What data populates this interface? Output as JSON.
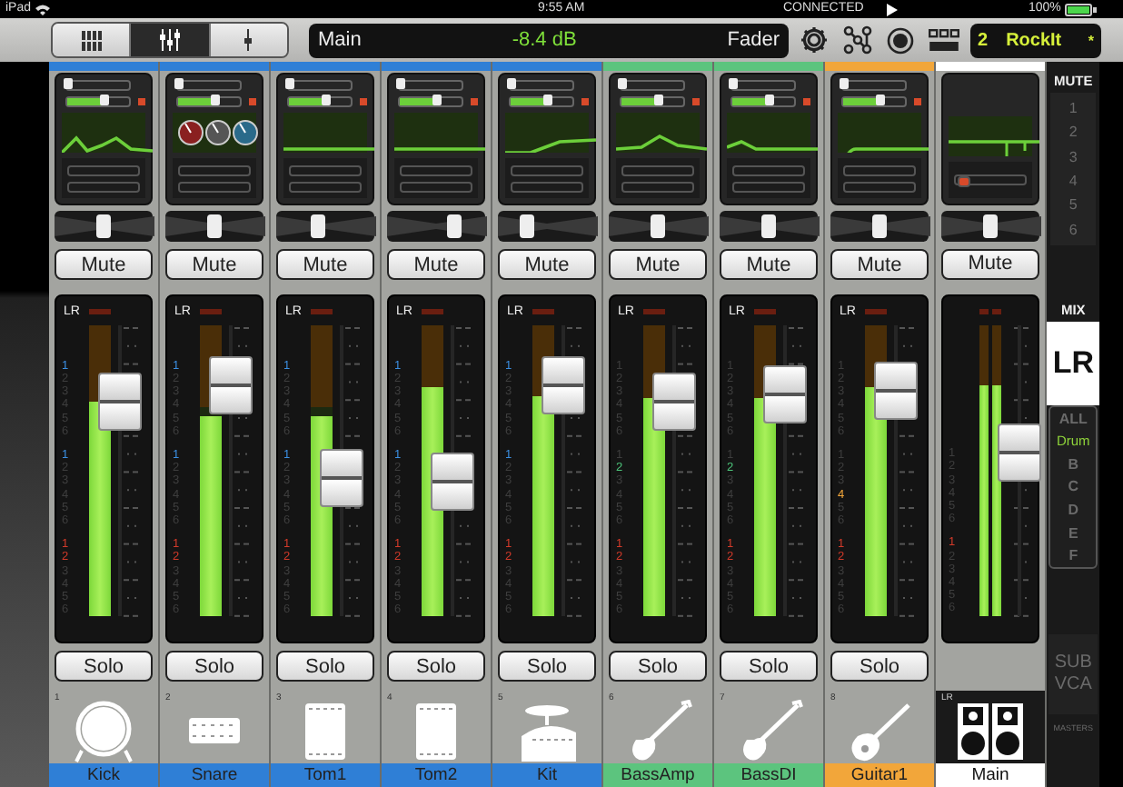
{
  "status_bar": {
    "device": "iPad",
    "time": "9:55 AM",
    "connection": "CONNECTED",
    "battery": "100%"
  },
  "toolbar": {
    "views": [
      {
        "selected": false
      },
      {
        "selected": true
      },
      {
        "selected": false
      }
    ],
    "display": {
      "target": "Main",
      "value": "-8.4 dB",
      "mode": "Fader"
    },
    "scene": {
      "number": "2",
      "name": "RockIt",
      "modified": "*"
    }
  },
  "channels": [
    {
      "kind": "input",
      "number": "1",
      "name": "Kick",
      "color": "#2f7fd6",
      "inputs": [
        {
          "level": 0
        },
        {
          "level": 0.6
        }
      ],
      "pan": {
        "level": 0.5
      },
      "mute": {
        "label": "Mute",
        "on": false
      },
      "bus": "LR",
      "groups": [
        {
          "digits": [
            "1",
            "2",
            "3",
            "4",
            "5",
            "6"
          ],
          "lit": [
            true,
            false,
            false,
            false,
            false,
            false
          ],
          "color": "#3b8ee0"
        },
        {
          "digits": [
            "1",
            "2",
            "3",
            "4",
            "5",
            "6"
          ],
          "lit": [
            true,
            false,
            false,
            false,
            false,
            false
          ],
          "color": "#3b8ee0"
        },
        {
          "digits": [
            "1",
            "2",
            "3",
            "4",
            "5",
            "6"
          ],
          "lit": [
            true,
            true,
            false,
            false,
            false,
            false
          ],
          "color": "#d23a2a"
        }
      ],
      "meter": {
        "level": 0.74
      },
      "fader": {
        "level": 0.7
      },
      "solo": {
        "label": "Solo",
        "on": false
      }
    },
    {
      "kind": "input",
      "number": "2",
      "name": "Snare",
      "color": "#2f7fd6",
      "inputs": [
        {
          "level": 0
        },
        {
          "level": 0.6
        }
      ],
      "pan": {
        "level": 0.5
      },
      "mute": {
        "label": "Mute",
        "on": false
      },
      "bus": "LR",
      "groups": [
        {
          "digits": [
            "1",
            "2",
            "3",
            "4",
            "5",
            "6"
          ],
          "lit": [
            true,
            false,
            false,
            false,
            false,
            false
          ],
          "color": "#3b8ee0"
        },
        {
          "digits": [
            "1",
            "2",
            "3",
            "4",
            "5",
            "6"
          ],
          "lit": [
            true,
            false,
            false,
            false,
            false,
            false
          ],
          "color": "#3b8ee0"
        },
        {
          "digits": [
            "1",
            "2",
            "3",
            "4",
            "5",
            "6"
          ],
          "lit": [
            true,
            true,
            false,
            false,
            false,
            false
          ],
          "color": "#d23a2a"
        }
      ],
      "meter": {
        "level": 0.69
      },
      "fader": {
        "level": 0.745
      },
      "solo": {
        "label": "Solo",
        "on": false
      }
    },
    {
      "kind": "input",
      "number": "3",
      "name": "Tom1",
      "color": "#2f7fd6",
      "inputs": [
        {
          "level": 0
        },
        {
          "level": 0.6
        }
      ],
      "pan": {
        "level": 0.42
      },
      "mute": {
        "label": "Mute",
        "on": false
      },
      "bus": "LR",
      "groups": [
        {
          "digits": [
            "1",
            "2",
            "3",
            "4",
            "5",
            "6"
          ],
          "lit": [
            true,
            false,
            false,
            false,
            false,
            false
          ],
          "color": "#3b8ee0"
        },
        {
          "digits": [
            "1",
            "2",
            "3",
            "4",
            "5",
            "6"
          ],
          "lit": [
            true,
            false,
            false,
            false,
            false,
            false
          ],
          "color": "#3b8ee0"
        },
        {
          "digits": [
            "1",
            "2",
            "3",
            "4",
            "5",
            "6"
          ],
          "lit": [
            true,
            true,
            false,
            false,
            false,
            false
          ],
          "color": "#d23a2a"
        }
      ],
      "meter": {
        "level": 0.69
      },
      "fader": {
        "level": 0.48
      },
      "solo": {
        "label": "Solo",
        "on": false
      }
    },
    {
      "kind": "input",
      "number": "4",
      "name": "Tom2",
      "color": "#2f7fd6",
      "inputs": [
        {
          "level": 0
        },
        {
          "level": 0.6
        }
      ],
      "pan": {
        "level": 0.68
      },
      "mute": {
        "label": "Mute",
        "on": false
      },
      "bus": "LR",
      "groups": [
        {
          "digits": [
            "1",
            "2",
            "3",
            "4",
            "5",
            "6"
          ],
          "lit": [
            true,
            false,
            false,
            false,
            false,
            false
          ],
          "color": "#3b8ee0"
        },
        {
          "digits": [
            "1",
            "2",
            "3",
            "4",
            "5",
            "6"
          ],
          "lit": [
            true,
            false,
            false,
            false,
            false,
            false
          ],
          "color": "#3b8ee0"
        },
        {
          "digits": [
            "1",
            "2",
            "3",
            "4",
            "5",
            "6"
          ],
          "lit": [
            true,
            true,
            false,
            false,
            false,
            false
          ],
          "color": "#d23a2a"
        }
      ],
      "meter": {
        "level": 0.79
      },
      "fader": {
        "level": 0.47
      },
      "solo": {
        "label": "Solo",
        "on": false
      }
    },
    {
      "kind": "input",
      "number": "5",
      "name": "Kit",
      "color": "#2f7fd6",
      "inputs": [
        {
          "level": 0
        },
        {
          "level": 0.6
        }
      ],
      "pan": {
        "level": 0.3
      },
      "mute": {
        "label": "Mute",
        "on": false
      },
      "bus": "LR",
      "groups": [
        {
          "digits": [
            "1",
            "2",
            "3",
            "4",
            "5",
            "6"
          ],
          "lit": [
            true,
            false,
            false,
            false,
            false,
            false
          ],
          "color": "#3b8ee0"
        },
        {
          "digits": [
            "1",
            "2",
            "3",
            "4",
            "5",
            "6"
          ],
          "lit": [
            true,
            false,
            false,
            false,
            false,
            false
          ],
          "color": "#3b8ee0"
        },
        {
          "digits": [
            "1",
            "2",
            "3",
            "4",
            "5",
            "6"
          ],
          "lit": [
            true,
            true,
            false,
            false,
            false,
            false
          ],
          "color": "#d23a2a"
        }
      ],
      "meter": {
        "level": 0.76
      },
      "fader": {
        "level": 0.745
      },
      "solo": {
        "label": "Solo",
        "on": false
      }
    },
    {
      "kind": "input",
      "number": "6",
      "name": "BassAmp",
      "color": "#5cc47e",
      "inputs": [
        {
          "level": 0
        },
        {
          "level": 0.6
        }
      ],
      "pan": {
        "level": 0.5
      },
      "mute": {
        "label": "Mute",
        "on": false
      },
      "bus": "LR",
      "groups": [
        {
          "digits": [
            "1",
            "2",
            "3",
            "4",
            "5",
            "6"
          ],
          "lit": [
            false,
            false,
            false,
            false,
            false,
            false
          ]
        },
        {
          "digits": [
            "1",
            "2",
            "3",
            "4",
            "5",
            "6"
          ],
          "lit": [
            false,
            true,
            false,
            false,
            false,
            false
          ],
          "color": "#4cc47a"
        },
        {
          "digits": [
            "1",
            "2",
            "3",
            "4",
            "5",
            "6"
          ],
          "lit": [
            true,
            true,
            false,
            false,
            false,
            false
          ],
          "color": "#d23a2a"
        }
      ],
      "meter": {
        "level": 0.75
      },
      "fader": {
        "level": 0.7
      },
      "solo": {
        "label": "Solo",
        "on": false
      }
    },
    {
      "kind": "input",
      "number": "7",
      "name": "BassDI",
      "color": "#5cc47e",
      "inputs": [
        {
          "level": 0
        },
        {
          "level": 0.6
        }
      ],
      "pan": {
        "level": 0.5
      },
      "mute": {
        "label": "Mute",
        "on": false
      },
      "bus": "LR",
      "groups": [
        {
          "digits": [
            "1",
            "2",
            "3",
            "4",
            "5",
            "6"
          ],
          "lit": [
            false,
            false,
            false,
            false,
            false,
            false
          ]
        },
        {
          "digits": [
            "1",
            "2",
            "3",
            "4",
            "5",
            "6"
          ],
          "lit": [
            false,
            true,
            false,
            false,
            false,
            false
          ],
          "color": "#4cc47a"
        },
        {
          "digits": [
            "1",
            "2",
            "3",
            "4",
            "5",
            "6"
          ],
          "lit": [
            true,
            true,
            false,
            false,
            false,
            false
          ],
          "color": "#d23a2a"
        }
      ],
      "meter": {
        "level": 0.75
      },
      "fader": {
        "level": 0.72
      },
      "solo": {
        "label": "Solo",
        "on": false
      }
    },
    {
      "kind": "input",
      "number": "8",
      "name": "Guitar1",
      "color": "#f2a63a",
      "inputs": [
        {
          "level": 0
        },
        {
          "level": 0.6
        }
      ],
      "pan": {
        "level": 0.5
      },
      "mute": {
        "label": "Mute",
        "on": false
      },
      "bus": "LR",
      "groups": [
        {
          "digits": [
            "1",
            "2",
            "3",
            "4",
            "5",
            "6"
          ],
          "lit": [
            false,
            false,
            false,
            false,
            false,
            false
          ]
        },
        {
          "digits": [
            "1",
            "2",
            "3",
            "4",
            "5",
            "6"
          ],
          "lit": [
            false,
            false,
            false,
            true,
            false,
            false
          ],
          "color": "#f2a63a"
        },
        {
          "digits": [
            "1",
            "2",
            "3",
            "4",
            "5",
            "6"
          ],
          "lit": [
            true,
            true,
            false,
            false,
            false,
            false
          ],
          "color": "#d23a2a"
        }
      ],
      "meter": {
        "level": 0.79
      },
      "fader": {
        "level": 0.73
      },
      "solo": {
        "label": "Solo",
        "on": false
      }
    },
    {
      "kind": "main",
      "number": "LR",
      "name": "Main",
      "color": "#ffffff",
      "pan": {
        "level": 0.5
      },
      "mute": {
        "label": "Mute",
        "on": false
      },
      "groups": [
        {
          "digits": [
            "1",
            "2",
            "3",
            "4",
            "5",
            "6"
          ],
          "lit": [
            false,
            false,
            false,
            false,
            false,
            false
          ]
        },
        {
          "digits": [
            "1",
            "2",
            "3",
            "4",
            "5",
            "6"
          ],
          "lit": [
            true,
            false,
            false,
            false,
            false,
            false
          ],
          "color": "#d23a2a"
        }
      ],
      "meter": {
        "level": 0.79
      },
      "fader": {
        "level": 0.55
      }
    }
  ],
  "side": {
    "mute_title": "MUTE",
    "mute_groups": [
      {
        "label": "1",
        "on": false
      },
      {
        "label": "2",
        "on": false
      },
      {
        "label": "3",
        "on": false
      },
      {
        "label": "4",
        "on": false
      },
      {
        "label": "5",
        "on": false
      },
      {
        "label": "6",
        "on": false
      }
    ],
    "mix_title": "MIX",
    "mix": [
      {
        "label": "LR",
        "selected": true
      },
      {
        "label": "ALL",
        "selected": false,
        "active": false
      },
      {
        "label": "Drum",
        "selected": false,
        "active": true
      },
      {
        "label": "B",
        "selected": false,
        "active": false
      },
      {
        "label": "C",
        "selected": false,
        "active": false
      },
      {
        "label": "D",
        "selected": false,
        "active": false
      },
      {
        "label": "E",
        "selected": false,
        "active": false
      },
      {
        "label": "F",
        "selected": false,
        "active": false
      }
    ],
    "sub": "SUB",
    "vca": "VCA",
    "masters": "MASTERS"
  }
}
